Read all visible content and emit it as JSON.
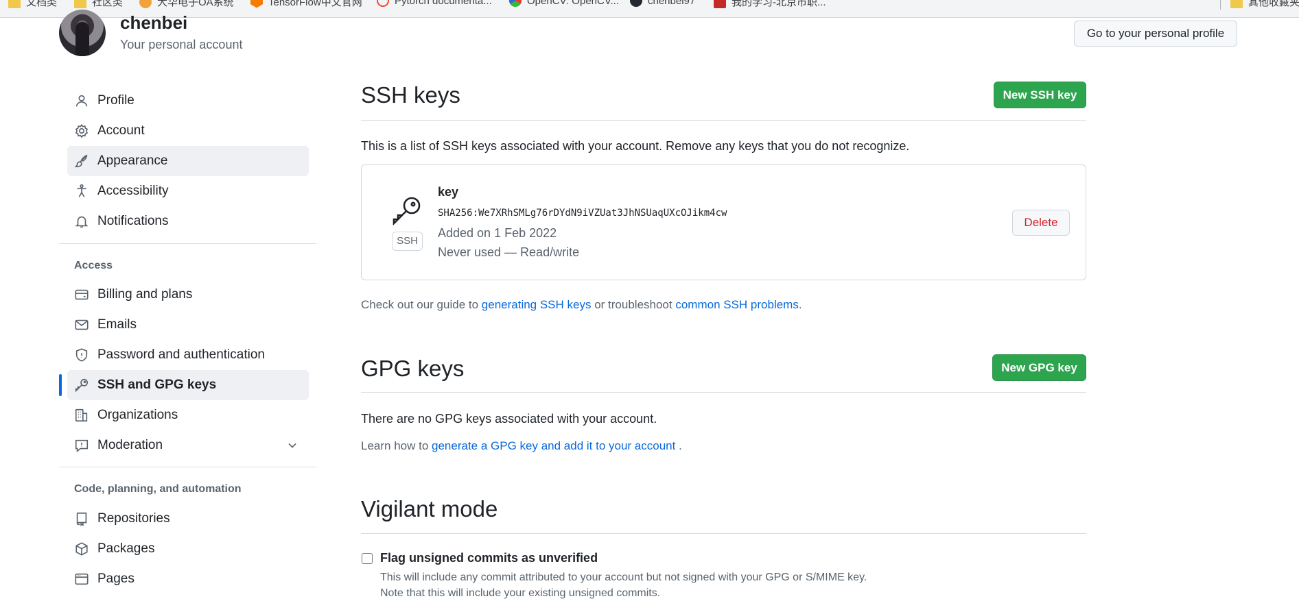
{
  "bookmarks": [
    {
      "label": "文档类",
      "icon": "folder-icon"
    },
    {
      "label": "社区类",
      "icon": "folder-icon"
    },
    {
      "label": "大华电子OA系统",
      "icon": "circle-orange-icon"
    },
    {
      "label": "TensorFlow中文官网",
      "icon": "tensorflow-icon"
    },
    {
      "label": "Pytorch documenta...",
      "icon": "pytorch-icon"
    },
    {
      "label": "OpenCV: OpenCV...",
      "icon": "opencv-icon"
    },
    {
      "label": "chenbei97",
      "icon": "github-icon"
    },
    {
      "label": "我的学习-北京市职...",
      "icon": "red-square-icon"
    },
    {
      "label": "其他收藏夹",
      "icon": "folder-icon"
    }
  ],
  "header": {
    "username": "chenbei",
    "subtitle": "Your personal account",
    "profile_button": "Go to your personal profile"
  },
  "sidebar": {
    "top_items": [
      {
        "label": "Profile",
        "icon": "person-icon"
      },
      {
        "label": "Account",
        "icon": "gear-icon"
      },
      {
        "label": "Appearance",
        "icon": "paintbrush-icon"
      },
      {
        "label": "Accessibility",
        "icon": "accessibility-icon"
      },
      {
        "label": "Notifications",
        "icon": "bell-icon"
      }
    ],
    "access_label": "Access",
    "access_items": [
      {
        "label": "Billing and plans",
        "icon": "credit-card-icon"
      },
      {
        "label": "Emails",
        "icon": "mail-icon"
      },
      {
        "label": "Password and authentication",
        "icon": "shield-icon"
      },
      {
        "label": "SSH and GPG keys",
        "icon": "key-icon"
      },
      {
        "label": "Organizations",
        "icon": "organization-icon"
      },
      {
        "label": "Moderation",
        "icon": "report-icon"
      }
    ],
    "code_label": "Code, planning, and automation",
    "code_items": [
      {
        "label": "Repositories",
        "icon": "repo-icon"
      },
      {
        "label": "Packages",
        "icon": "package-icon"
      },
      {
        "label": "Pages",
        "icon": "browser-icon"
      }
    ]
  },
  "ssh": {
    "title": "SSH keys",
    "new_button": "New SSH key",
    "description": "This is a list of SSH keys associated with your account. Remove any keys that you do not recognize.",
    "key": {
      "badge": "SSH",
      "title": "key",
      "fingerprint": "SHA256:We7XRhSMLg76rDYdN9iVZUat3JhNSUaqUXcOJikm4cw",
      "added": "Added on 1 Feb 2022",
      "used": "Never used — Read/write",
      "delete_button": "Delete"
    },
    "guide_prefix": "Check out our guide to ",
    "guide_link1": "generating SSH keys",
    "guide_mid": " or troubleshoot ",
    "guide_link2": "common SSH problems",
    "guide_suffix": "."
  },
  "gpg": {
    "title": "GPG keys",
    "new_button": "New GPG key",
    "empty": "There are no GPG keys associated with your account.",
    "learn_prefix": "Learn how to ",
    "learn_link": "generate a GPG key and add it to your account",
    "learn_suffix": " ."
  },
  "vigilant": {
    "title": "Vigilant mode",
    "checkbox_label": "Flag unsigned commits as unverified",
    "desc1": "This will include any commit attributed to your account but not signed with your GPG or S/MIME key.",
    "desc2": "Note that this will include your existing unsigned commits."
  }
}
